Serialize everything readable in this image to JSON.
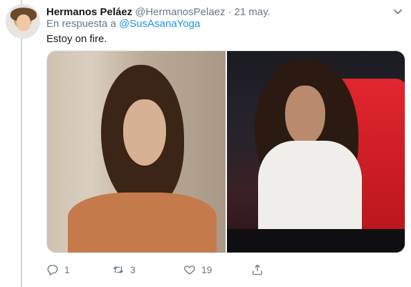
{
  "tweet": {
    "author_name": "Hermanos Peláez",
    "author_handle": "@HermanosPelaez",
    "separator": "·",
    "date": "21 may.",
    "reply_prefix": "En respuesta a",
    "reply_to": "@SusAsanaYoga",
    "text": "Estoy on fire."
  },
  "icons": {
    "menu": "chevron-down-icon",
    "reply": "reply-icon",
    "retweet": "retweet-icon",
    "like": "heart-icon",
    "share": "share-icon"
  },
  "stats": {
    "replies": "1",
    "retweets": "3",
    "likes": "19"
  },
  "colors": {
    "link": "#1b95e0",
    "muted": "#657786",
    "text": "#14171a"
  }
}
